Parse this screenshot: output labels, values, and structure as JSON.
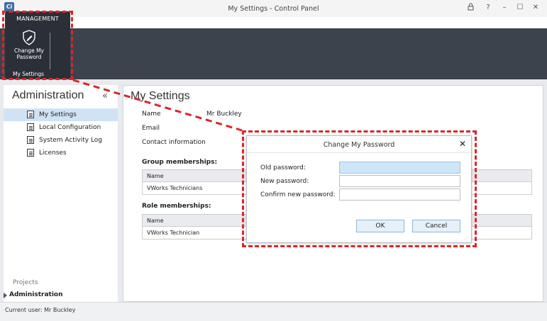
{
  "window": {
    "logo_text": "Ci",
    "title": "My Settings - Control Panel",
    "controls": {
      "lock_icon": "🔒",
      "help": "?",
      "minimize": "–",
      "maximize": "☐",
      "close": "✕"
    }
  },
  "ribbon": {
    "tab_label": "MANAGEMENT",
    "change_password_label": "Change My\nPassword",
    "group_label": "My Settings"
  },
  "sidebar": {
    "title": "Administration",
    "collapse_glyph": "«",
    "items": [
      {
        "label": "My Settings",
        "icon": "settings-page-icon",
        "selected": true
      },
      {
        "label": "Local Configuration",
        "icon": "configuration-icon",
        "selected": false
      },
      {
        "label": "System Activity Log",
        "icon": "log-icon",
        "selected": false
      },
      {
        "label": "Licenses",
        "icon": "license-icon",
        "selected": false
      }
    ],
    "projects_label": "Projects",
    "administration_label": "Administration"
  },
  "content": {
    "title": "My Settings",
    "name_label": "Name",
    "name_value": "Mr Buckley",
    "email_label": "Email",
    "contact_label": "Contact information",
    "group_heading": "Group memberships:",
    "group_table": {
      "header": "Name",
      "rows": [
        "VWorks Technicians"
      ]
    },
    "role_heading": "Role memberships:",
    "role_table": {
      "header": "Name",
      "rows": [
        "VWorks Technician"
      ]
    }
  },
  "dialog": {
    "title": "Change My Password",
    "close_glyph": "✕",
    "old_password_label": "Old password:",
    "new_password_label": "New password:",
    "confirm_password_label": "Confirm new password:",
    "ok_label": "OK",
    "cancel_label": "Cancel"
  },
  "status": {
    "text": "Current user: Mr Buckley"
  },
  "colors": {
    "annotation": "#d9262c",
    "ribbon_dark": "#3d434c",
    "selection": "#cfe3f5"
  }
}
